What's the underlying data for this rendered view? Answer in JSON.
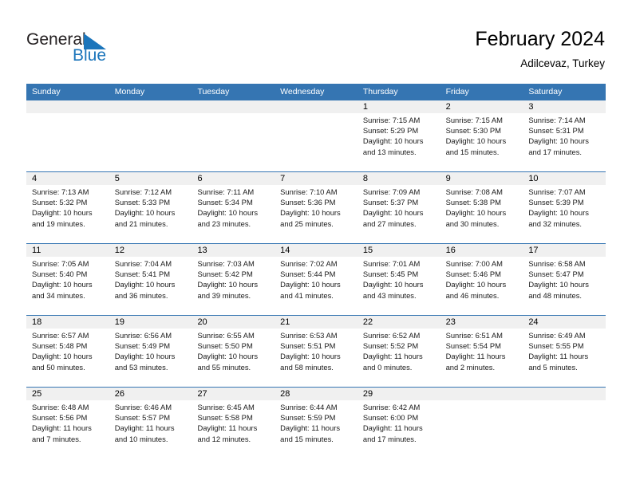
{
  "brand": {
    "name_part1": "General",
    "name_part2": "Blue",
    "flag_color": "#1b75bb"
  },
  "header": {
    "title": "February 2024",
    "subtitle": "Adilcevaz, Turkey"
  },
  "colors": {
    "header_bar": "#3575b2",
    "row_band": "#f0f0f0",
    "brand_blue": "#1b75bb"
  },
  "weekdays": [
    "Sunday",
    "Monday",
    "Tuesday",
    "Wednesday",
    "Thursday",
    "Friday",
    "Saturday"
  ],
  "labels": {
    "sunrise_prefix": "Sunrise:",
    "sunset_prefix": "Sunset:",
    "daylight_prefix": "Daylight:"
  },
  "weeks": [
    {
      "days": [
        {
          "num": "",
          "l1": "",
          "l2": "",
          "l3": "",
          "l4": ""
        },
        {
          "num": "",
          "l1": "",
          "l2": "",
          "l3": "",
          "l4": ""
        },
        {
          "num": "",
          "l1": "",
          "l2": "",
          "l3": "",
          "l4": ""
        },
        {
          "num": "",
          "l1": "",
          "l2": "",
          "l3": "",
          "l4": ""
        },
        {
          "num": "1",
          "l1": "Sunrise: 7:15 AM",
          "l2": "Sunset: 5:29 PM",
          "l3": "Daylight: 10 hours",
          "l4": "and 13 minutes."
        },
        {
          "num": "2",
          "l1": "Sunrise: 7:15 AM",
          "l2": "Sunset: 5:30 PM",
          "l3": "Daylight: 10 hours",
          "l4": "and 15 minutes."
        },
        {
          "num": "3",
          "l1": "Sunrise: 7:14 AM",
          "l2": "Sunset: 5:31 PM",
          "l3": "Daylight: 10 hours",
          "l4": "and 17 minutes."
        }
      ]
    },
    {
      "days": [
        {
          "num": "4",
          "l1": "Sunrise: 7:13 AM",
          "l2": "Sunset: 5:32 PM",
          "l3": "Daylight: 10 hours",
          "l4": "and 19 minutes."
        },
        {
          "num": "5",
          "l1": "Sunrise: 7:12 AM",
          "l2": "Sunset: 5:33 PM",
          "l3": "Daylight: 10 hours",
          "l4": "and 21 minutes."
        },
        {
          "num": "6",
          "l1": "Sunrise: 7:11 AM",
          "l2": "Sunset: 5:34 PM",
          "l3": "Daylight: 10 hours",
          "l4": "and 23 minutes."
        },
        {
          "num": "7",
          "l1": "Sunrise: 7:10 AM",
          "l2": "Sunset: 5:36 PM",
          "l3": "Daylight: 10 hours",
          "l4": "and 25 minutes."
        },
        {
          "num": "8",
          "l1": "Sunrise: 7:09 AM",
          "l2": "Sunset: 5:37 PM",
          "l3": "Daylight: 10 hours",
          "l4": "and 27 minutes."
        },
        {
          "num": "9",
          "l1": "Sunrise: 7:08 AM",
          "l2": "Sunset: 5:38 PM",
          "l3": "Daylight: 10 hours",
          "l4": "and 30 minutes."
        },
        {
          "num": "10",
          "l1": "Sunrise: 7:07 AM",
          "l2": "Sunset: 5:39 PM",
          "l3": "Daylight: 10 hours",
          "l4": "and 32 minutes."
        }
      ]
    },
    {
      "days": [
        {
          "num": "11",
          "l1": "Sunrise: 7:05 AM",
          "l2": "Sunset: 5:40 PM",
          "l3": "Daylight: 10 hours",
          "l4": "and 34 minutes."
        },
        {
          "num": "12",
          "l1": "Sunrise: 7:04 AM",
          "l2": "Sunset: 5:41 PM",
          "l3": "Daylight: 10 hours",
          "l4": "and 36 minutes."
        },
        {
          "num": "13",
          "l1": "Sunrise: 7:03 AM",
          "l2": "Sunset: 5:42 PM",
          "l3": "Daylight: 10 hours",
          "l4": "and 39 minutes."
        },
        {
          "num": "14",
          "l1": "Sunrise: 7:02 AM",
          "l2": "Sunset: 5:44 PM",
          "l3": "Daylight: 10 hours",
          "l4": "and 41 minutes."
        },
        {
          "num": "15",
          "l1": "Sunrise: 7:01 AM",
          "l2": "Sunset: 5:45 PM",
          "l3": "Daylight: 10 hours",
          "l4": "and 43 minutes."
        },
        {
          "num": "16",
          "l1": "Sunrise: 7:00 AM",
          "l2": "Sunset: 5:46 PM",
          "l3": "Daylight: 10 hours",
          "l4": "and 46 minutes."
        },
        {
          "num": "17",
          "l1": "Sunrise: 6:58 AM",
          "l2": "Sunset: 5:47 PM",
          "l3": "Daylight: 10 hours",
          "l4": "and 48 minutes."
        }
      ]
    },
    {
      "days": [
        {
          "num": "18",
          "l1": "Sunrise: 6:57 AM",
          "l2": "Sunset: 5:48 PM",
          "l3": "Daylight: 10 hours",
          "l4": "and 50 minutes."
        },
        {
          "num": "19",
          "l1": "Sunrise: 6:56 AM",
          "l2": "Sunset: 5:49 PM",
          "l3": "Daylight: 10 hours",
          "l4": "and 53 minutes."
        },
        {
          "num": "20",
          "l1": "Sunrise: 6:55 AM",
          "l2": "Sunset: 5:50 PM",
          "l3": "Daylight: 10 hours",
          "l4": "and 55 minutes."
        },
        {
          "num": "21",
          "l1": "Sunrise: 6:53 AM",
          "l2": "Sunset: 5:51 PM",
          "l3": "Daylight: 10 hours",
          "l4": "and 58 minutes."
        },
        {
          "num": "22",
          "l1": "Sunrise: 6:52 AM",
          "l2": "Sunset: 5:52 PM",
          "l3": "Daylight: 11 hours",
          "l4": "and 0 minutes."
        },
        {
          "num": "23",
          "l1": "Sunrise: 6:51 AM",
          "l2": "Sunset: 5:54 PM",
          "l3": "Daylight: 11 hours",
          "l4": "and 2 minutes."
        },
        {
          "num": "24",
          "l1": "Sunrise: 6:49 AM",
          "l2": "Sunset: 5:55 PM",
          "l3": "Daylight: 11 hours",
          "l4": "and 5 minutes."
        }
      ]
    },
    {
      "days": [
        {
          "num": "25",
          "l1": "Sunrise: 6:48 AM",
          "l2": "Sunset: 5:56 PM",
          "l3": "Daylight: 11 hours",
          "l4": "and 7 minutes."
        },
        {
          "num": "26",
          "l1": "Sunrise: 6:46 AM",
          "l2": "Sunset: 5:57 PM",
          "l3": "Daylight: 11 hours",
          "l4": "and 10 minutes."
        },
        {
          "num": "27",
          "l1": "Sunrise: 6:45 AM",
          "l2": "Sunset: 5:58 PM",
          "l3": "Daylight: 11 hours",
          "l4": "and 12 minutes."
        },
        {
          "num": "28",
          "l1": "Sunrise: 6:44 AM",
          "l2": "Sunset: 5:59 PM",
          "l3": "Daylight: 11 hours",
          "l4": "and 15 minutes."
        },
        {
          "num": "29",
          "l1": "Sunrise: 6:42 AM",
          "l2": "Sunset: 6:00 PM",
          "l3": "Daylight: 11 hours",
          "l4": "and 17 minutes."
        },
        {
          "num": "",
          "l1": "",
          "l2": "",
          "l3": "",
          "l4": ""
        },
        {
          "num": "",
          "l1": "",
          "l2": "",
          "l3": "",
          "l4": ""
        }
      ]
    }
  ]
}
